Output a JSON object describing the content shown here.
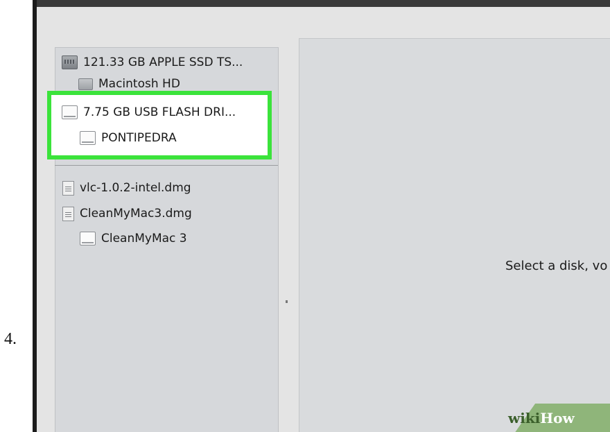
{
  "step_number": "4.",
  "sidebar": {
    "items": [
      {
        "label": "121.33 GB APPLE SSD TS...",
        "icon": "internal-disk-icon"
      },
      {
        "label": "Macintosh HD",
        "icon": "volume-icon"
      },
      {
        "label": "7.75 GB USB FLASH DRI...",
        "icon": "usb-drive-icon"
      },
      {
        "label": "PONTIPEDRA",
        "icon": "usb-volume-icon"
      },
      {
        "label": "vlc-1.0.2-intel.dmg",
        "icon": "disk-image-icon"
      },
      {
        "label": "CleanMyMac3.dmg",
        "icon": "disk-image-icon"
      },
      {
        "label": "CleanMyMac 3",
        "icon": "mounted-volume-icon"
      }
    ]
  },
  "detail": {
    "message": "Select a disk, vo"
  },
  "watermark": {
    "part1": "wiki",
    "part2": "How"
  },
  "colors": {
    "highlight": "#3be33b",
    "sidebar_bg": "#d6d8db",
    "window_bg": "#e4e4e4",
    "watermark_bg": "#8fb57a"
  }
}
